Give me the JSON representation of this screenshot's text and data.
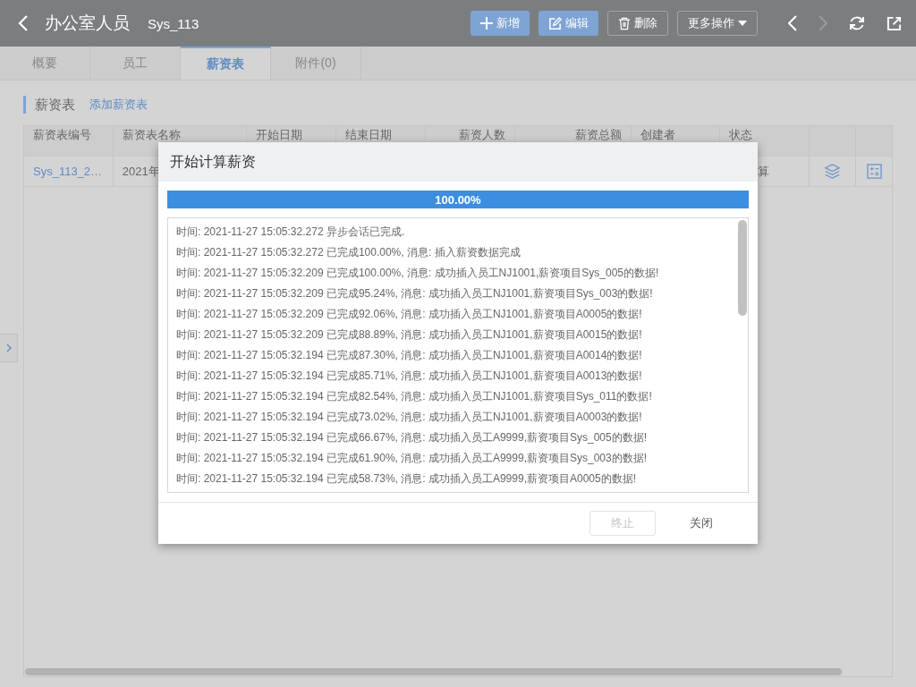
{
  "header": {
    "title": "办公室人员",
    "code": "Sys_113",
    "buttons": [
      {
        "label": "新增",
        "kind": "add"
      },
      {
        "label": "编辑",
        "kind": "edit"
      },
      {
        "label": "删除",
        "kind": "delete"
      },
      {
        "label": "更多操作",
        "kind": "more"
      }
    ],
    "nav": [
      {
        "kind": "prev",
        "disabled": false
      },
      {
        "kind": "next",
        "disabled": true
      },
      {
        "kind": "refresh",
        "disabled": false
      },
      {
        "kind": "open",
        "disabled": false
      }
    ]
  },
  "tabs": [
    {
      "label": "概要",
      "selected": false
    },
    {
      "label": "员工",
      "selected": false
    },
    {
      "label": "薪资表",
      "selected": true
    },
    {
      "label": "附件(0)",
      "selected": false
    }
  ],
  "section": {
    "title": "薪资表",
    "link": "添加薪资表"
  },
  "table": {
    "columns": [
      "薪资表编号",
      "薪资表名称",
      "开始日期",
      "结束日期",
      "薪资人数",
      "薪资总额",
      "创建者",
      "状态"
    ],
    "rows": [
      {
        "code": "Sys_113_2…",
        "name": "2021年",
        "status": "算"
      }
    ]
  },
  "dialog": {
    "title": "开始计算薪资",
    "progress": {
      "level": 1,
      "label": "100.00%"
    },
    "log": [
      "时间: 2021-11-27 15:05:32.272 异步会话已完成.",
      "时间: 2021-11-27 15:05:32.272 已完成100.00%, 消息: 插入薪资数据完成",
      "时间: 2021-11-27 15:05:32.209 已完成100.00%, 消息: 成功插入员工NJ1001,薪资项目Sys_005的数据!",
      "时间: 2021-11-27 15:05:32.209 已完成95.24%, 消息: 成功插入员工NJ1001,薪资项目Sys_003的数据!",
      "时间: 2021-11-27 15:05:32.209 已完成92.06%, 消息: 成功插入员工NJ1001,薪资项目A0005的数据!",
      "时间: 2021-11-27 15:05:32.209 已完成88.89%, 消息: 成功插入员工NJ1001,薪资项目A0015的数据!",
      "时间: 2021-11-27 15:05:32.194 已完成87.30%, 消息: 成功插入员工NJ1001,薪资项目A0014的数据!",
      "时间: 2021-11-27 15:05:32.194 已完成85.71%, 消息: 成功插入员工NJ1001,薪资项目A0013的数据!",
      "时间: 2021-11-27 15:05:32.194 已完成82.54%, 消息: 成功插入员工NJ1001,薪资项目Sys_011的数据!",
      "时间: 2021-11-27 15:05:32.194 已完成73.02%, 消息: 成功插入员工NJ1001,薪资项目A0003的数据!",
      "时间: 2021-11-27 15:05:32.194 已完成66.67%, 消息: 成功插入员工A9999,薪资项目Sys_005的数据!",
      "时间: 2021-11-27 15:05:32.194 已完成61.90%, 消息: 成功插入员工A9999,薪资项目Sys_003的数据!",
      "时间: 2021-11-27 15:05:32.194 已完成58.73%, 消息: 成功插入员工A9999,薪资项目A0005的数据!"
    ],
    "buttons": [
      {
        "label": "终止",
        "disabled": true
      },
      {
        "label": "关闭",
        "disabled": false
      }
    ]
  }
}
